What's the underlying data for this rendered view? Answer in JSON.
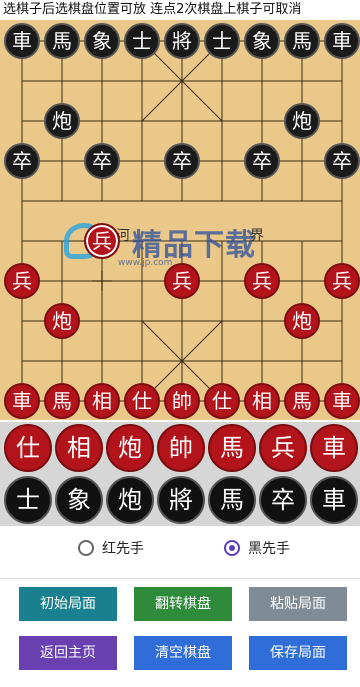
{
  "hint_text": "选棋子后选棋盘位置可放 连点2次棋盘上棋子可取消",
  "board": {
    "river_left": "河",
    "river_right": "界",
    "watermark": "精品下载",
    "watermark_sub": "www.jp.com"
  },
  "pieces": {
    "black_top_row": [
      "車",
      "馬",
      "象",
      "士",
      "將",
      "士",
      "象",
      "馬",
      "車"
    ],
    "black_cannon_left": "炮",
    "black_cannon_right": "炮",
    "black_pawns": [
      "卒",
      "卒",
      "卒",
      "卒",
      "卒"
    ],
    "red_pawn_crossed": "兵",
    "red_pawns": [
      "兵",
      "兵",
      "兵",
      "兵"
    ],
    "red_cannon_left": "炮",
    "red_cannon_right": "炮",
    "red_bottom_row": [
      "車",
      "馬",
      "相",
      "仕",
      "帥",
      "仕",
      "相",
      "馬",
      "車"
    ]
  },
  "tray": {
    "red": [
      "仕",
      "相",
      "炮",
      "帥",
      "馬",
      "兵",
      "車"
    ],
    "black": [
      "士",
      "象",
      "炮",
      "將",
      "馬",
      "卒",
      "車"
    ]
  },
  "radios": {
    "red_first": "红先手",
    "black_first": "黑先手",
    "selected": "black_first"
  },
  "buttons": {
    "initial": "初始局面",
    "flip": "翻转棋盘",
    "paste": "粘贴局面",
    "home": "返回主页",
    "clear": "清空棋盘",
    "save": "保存局面"
  },
  "colors": {
    "board": "#e9c889",
    "red_piece": "#b3141b",
    "black_piece": "#1a1a1a",
    "btn_teal": "#1a7f8e",
    "btn_green": "#2e8b3a",
    "btn_gray": "#7f8c95",
    "btn_purple": "#6a3fb0",
    "btn_blue": "#2f6ed8"
  }
}
